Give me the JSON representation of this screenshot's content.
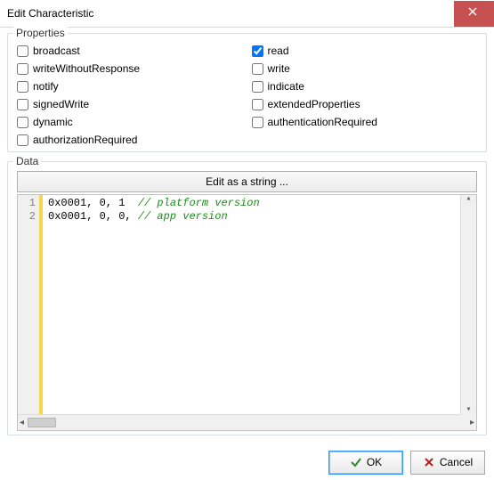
{
  "window": {
    "title": "Edit Characteristic"
  },
  "properties": {
    "legend": "Properties",
    "items": [
      {
        "label": "broadcast",
        "checked": false
      },
      {
        "label": "read",
        "checked": true
      },
      {
        "label": "writeWithoutResponse",
        "checked": false
      },
      {
        "label": "write",
        "checked": false
      },
      {
        "label": "notify",
        "checked": false
      },
      {
        "label": "indicate",
        "checked": false
      },
      {
        "label": "signedWrite",
        "checked": false
      },
      {
        "label": "extendedProperties",
        "checked": false
      },
      {
        "label": "dynamic",
        "checked": false
      },
      {
        "label": "authenticationRequired",
        "checked": false
      },
      {
        "label": "authorizationRequired",
        "checked": false
      }
    ]
  },
  "data_section": {
    "legend": "Data",
    "edit_as_string_label": "Edit as a string ...",
    "code_lines": [
      {
        "n": "1",
        "code": "0x0001, 0, 1  ",
        "comment": "// platform version"
      },
      {
        "n": "2",
        "code": "0x0001, 0, 0, ",
        "comment": "// app version"
      }
    ]
  },
  "buttons": {
    "ok": "OK",
    "cancel": "Cancel"
  }
}
